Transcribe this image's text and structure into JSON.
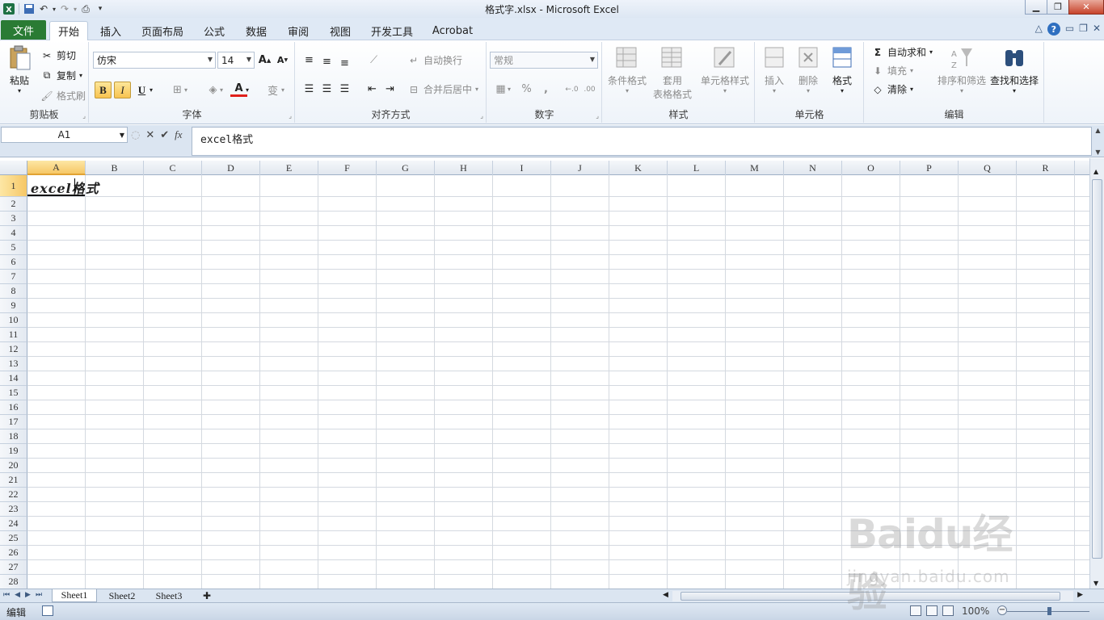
{
  "window": {
    "title": "格式字.xlsx - Microsoft Excel"
  },
  "ribbon_tabs": {
    "file": "文件",
    "items": [
      "开始",
      "插入",
      "页面布局",
      "公式",
      "数据",
      "审阅",
      "视图",
      "开发工具",
      "Acrobat"
    ],
    "active": "开始"
  },
  "clipboard": {
    "paste": "粘贴",
    "cut": "剪切",
    "copy": "复制",
    "format_painter": "格式刷",
    "label": "剪贴板"
  },
  "font": {
    "name": "仿宋",
    "size": "14",
    "label": "字体"
  },
  "alignment": {
    "wrap": "自动换行",
    "merge": "合并后居中",
    "label": "对齐方式"
  },
  "number": {
    "format": "常规",
    "label": "数字"
  },
  "styles": {
    "conditional": "条件格式",
    "table_line1": "套用",
    "table_line2": "表格格式",
    "cell_styles": "单元格样式",
    "label": "样式"
  },
  "cells_group": {
    "insert": "插入",
    "delete": "删除",
    "format": "格式",
    "label": "单元格"
  },
  "editing": {
    "autosum": "自动求和",
    "fill": "填充",
    "clear": "清除",
    "sort": "排序和筛选",
    "find": "查找和选择",
    "label": "编辑"
  },
  "formula_bar": {
    "name_box": "A1",
    "content": "excel格式"
  },
  "grid": {
    "columns": [
      "A",
      "B",
      "C",
      "D",
      "E",
      "F",
      "G",
      "H",
      "I",
      "J",
      "K",
      "L",
      "M",
      "N",
      "O",
      "P",
      "Q",
      "R"
    ],
    "rows": [
      "1",
      "2",
      "3",
      "4",
      "5",
      "6",
      "7",
      "8",
      "9",
      "10",
      "11",
      "12",
      "13",
      "14",
      "15",
      "16",
      "17",
      "18",
      "19",
      "20",
      "21",
      "22",
      "23",
      "24",
      "25",
      "26",
      "27",
      "28"
    ],
    "a1_value": "excel格式"
  },
  "sheets": [
    "Sheet1",
    "Sheet2",
    "Sheet3"
  ],
  "status": {
    "mode": "编辑",
    "zoom": "100%"
  },
  "watermark": {
    "logo": "Baidu经验",
    "url": "jingyan.baidu.com"
  },
  "colors": {
    "file_tab": "#2a7b34",
    "selected_header": "#f6c766"
  }
}
